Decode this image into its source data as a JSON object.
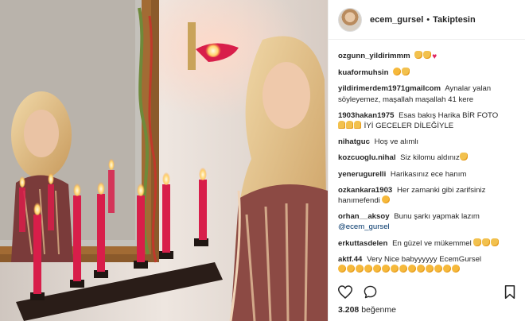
{
  "header": {
    "username": "ecem_gursel",
    "separator": "•",
    "follow_label": "Takiptesin"
  },
  "comments": [
    {
      "user": "ozgunn_yildirimmm",
      "text": "",
      "emojis": [
        "hand",
        "hand",
        "heart"
      ]
    },
    {
      "user": "kuaformuhsin",
      "text": "",
      "emojis": [
        "face",
        "hand"
      ]
    },
    {
      "user": "yildirimerdem1971gmailcom",
      "text": "Aynalar yalan söyleyemez, maşallah maşallah 41 kere",
      "emojis": []
    },
    {
      "user": "1903hakan1975",
      "text": "Esas bakış Harika BİR FOTO",
      "text2": "İYİ GECELER DİLEĞİYLE",
      "emojis": [
        "pray",
        "pray",
        "pray"
      ]
    },
    {
      "user": "nihatguc",
      "text": "Hoş ve alımlı",
      "emojis": []
    },
    {
      "user": "kozcuoglu.nihal",
      "text": "Siz kilomu aldınız",
      "emojis": [
        "hand"
      ]
    },
    {
      "user": "yenerugurelli",
      "text": "Harikasınız ece hanım",
      "emojis": []
    },
    {
      "user": "ozkankara1903",
      "text": "Her zamanki gibi zarifsiniz hanımefendi",
      "emojis": [
        "face"
      ]
    },
    {
      "user": "orhan__aksoy",
      "text": "Bunu şarkı yapmak lazım",
      "mention": "@ecem_gursel",
      "emojis": []
    },
    {
      "user": "erkuttasdelen",
      "text": "En güzel ve mükemmel",
      "emojis": [
        "hand",
        "hand",
        "hand"
      ]
    },
    {
      "user": "aktf.44",
      "text": "Very Nice babyyyyyy EcemGursel",
      "emojis": [
        "face",
        "face",
        "face",
        "face",
        "face",
        "face",
        "face",
        "face",
        "face",
        "face",
        "face",
        "face",
        "face",
        "face"
      ]
    }
  ],
  "actions": {
    "like_icon": "heart-outline-icon",
    "comment_icon": "comment-bubble-icon",
    "bookmark_icon": "bookmark-icon"
  },
  "likes": {
    "count": "3.208",
    "label": "beğenme"
  },
  "colors": {
    "text": "#262626",
    "border": "#efefef",
    "link": "#003569",
    "candle": "#d81e4a"
  }
}
